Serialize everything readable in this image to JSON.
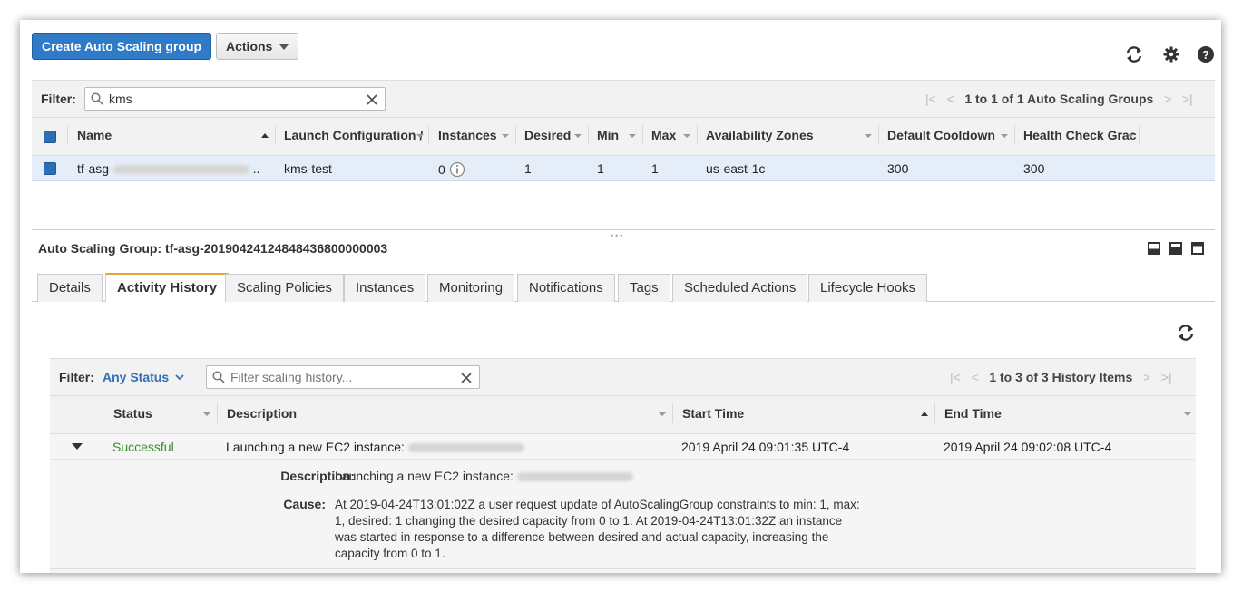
{
  "toolbar": {
    "create_label": "Create Auto Scaling group",
    "actions_label": "Actions"
  },
  "top_filter": {
    "label": "Filter:",
    "value": "kms",
    "pager": "1 to 1 of 1 Auto Scaling Groups"
  },
  "groups_table": {
    "columns": [
      "Name",
      "Launch Configuration /",
      "Instances",
      "Desired",
      "Min",
      "Max",
      "Availability Zones",
      "Default Cooldown",
      "Health Check Grac"
    ],
    "row": {
      "name_prefix": "tf-asg-",
      "name_suffix": "..",
      "launch_config": "kms-test",
      "instances": "0",
      "desired": "1",
      "min": "1",
      "max": "1",
      "zones": "us-east-1c",
      "cooldown": "300",
      "health_grace": "300"
    }
  },
  "details_panel": {
    "title": "Auto Scaling Group: tf-asg-20190424124848436800000003",
    "tabs": [
      "Details",
      "Activity History",
      "Scaling Policies",
      "Instances",
      "Monitoring",
      "Notifications",
      "Tags",
      "Scheduled Actions",
      "Lifecycle Hooks"
    ],
    "active_tab": "Activity History"
  },
  "history_filter": {
    "label": "Filter:",
    "status_value": "Any Status",
    "placeholder": "Filter scaling history...",
    "pager": "1 to 3 of 3 History Items"
  },
  "history_table": {
    "columns": [
      "Status",
      "Description",
      "Start Time",
      "End Time"
    ],
    "row": {
      "status": "Successful",
      "description": "Launching a new EC2 instance:",
      "start_time": "2019 April 24 09:01:35 UTC-4",
      "end_time": "2019 April 24 09:02:08 UTC-4"
    },
    "detail": {
      "description_label": "Description:",
      "description_value": "Launching a new EC2 instance:",
      "cause_label": "Cause:",
      "cause_lines": [
        "At 2019-04-24T13:01:02Z a user request update of AutoScalingGroup constraints to min: 1, max:",
        "1, desired: 1 changing the desired capacity from 0 to 1. At 2019-04-24T13:01:32Z an instance",
        "was started in response to a difference between desired and actual capacity, increasing the",
        "capacity from 0 to 1."
      ]
    }
  },
  "colors": {
    "primary": "#2f7bc7",
    "link": "#2f6fb3",
    "success": "#3a8a2e",
    "active_tab_accent": "#e8a23d"
  },
  "icons": [
    "refresh-icon",
    "gear-icon",
    "help-icon",
    "search-icon",
    "clear-icon",
    "first-page-icon",
    "prev-page-icon",
    "next-page-icon",
    "last-page-icon",
    "info-icon",
    "panel-layout-icons"
  ]
}
